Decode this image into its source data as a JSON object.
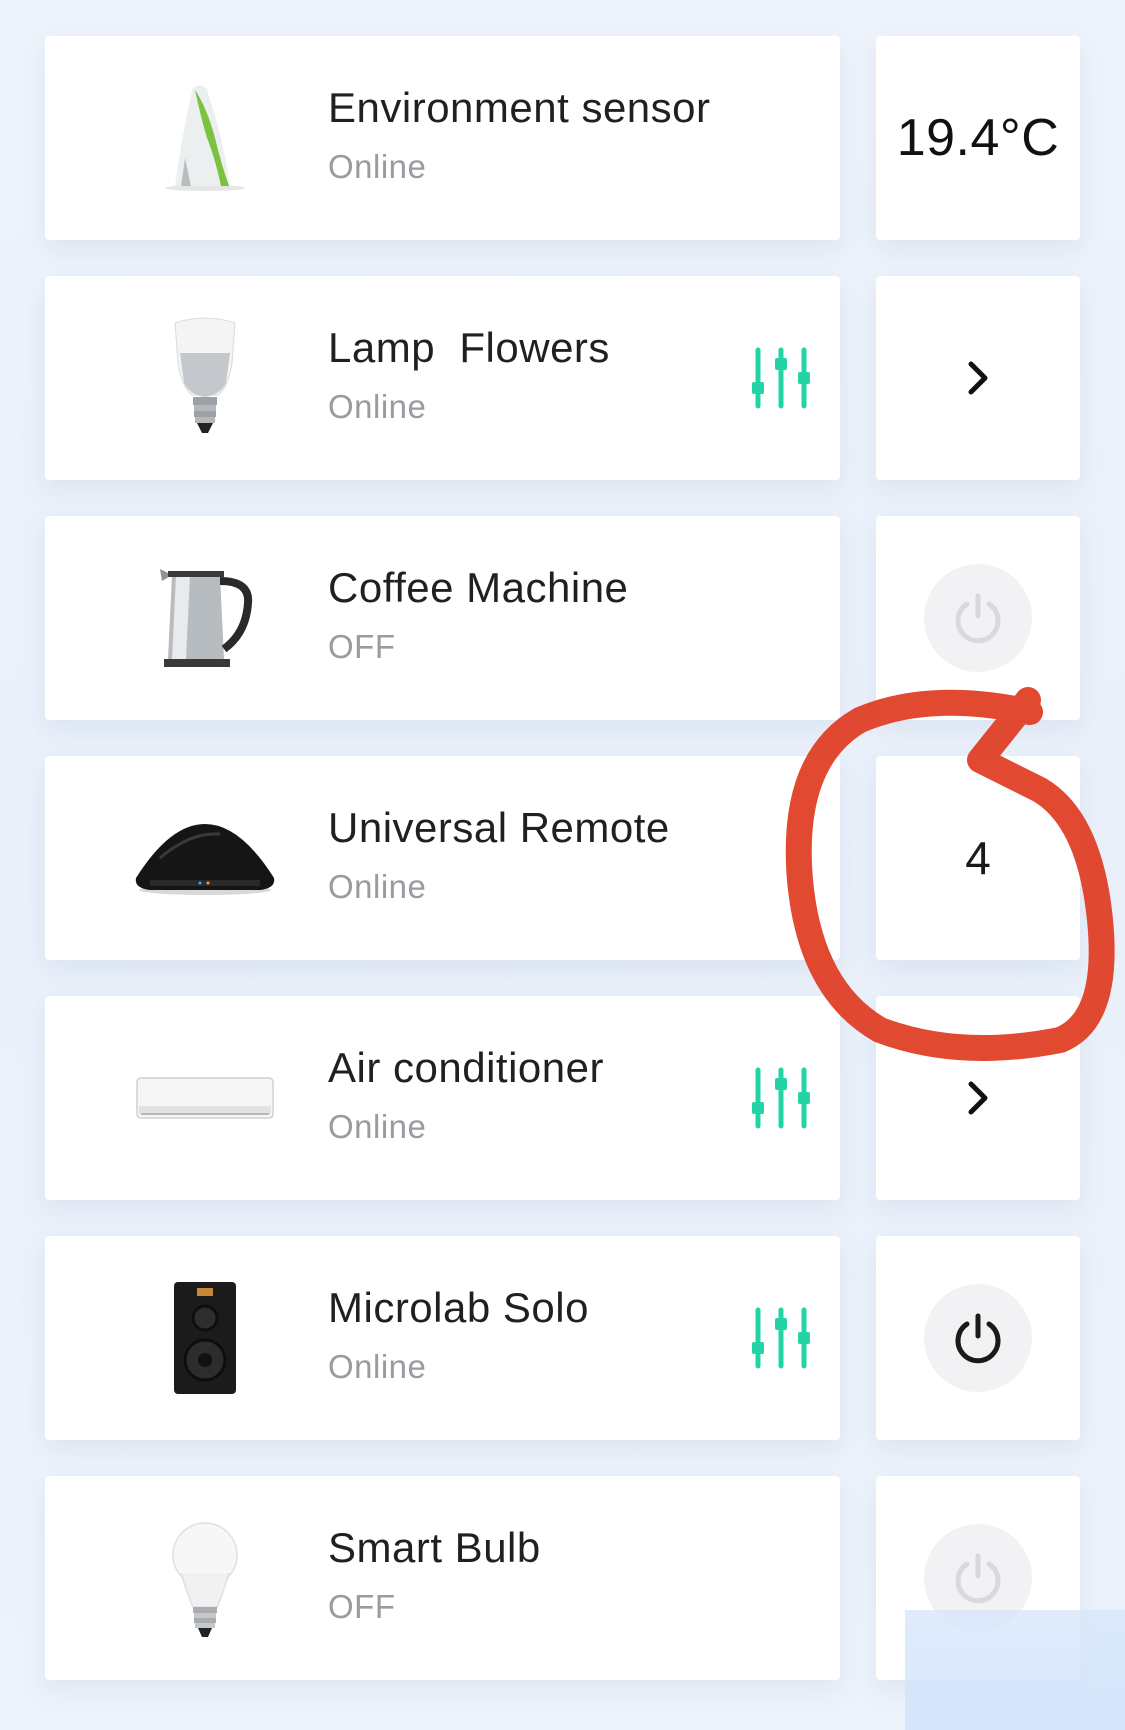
{
  "colors": {
    "accent": "#22d3a5",
    "text": "#1f1f24",
    "muted": "#9a9aa0",
    "annotation": "#e03a1f",
    "power_off": "#d9d9dc",
    "power_on": "#1a1a1a"
  },
  "devices": [
    {
      "name": "Environment sensor",
      "status": "Online",
      "icon": "environment-sensor-icon",
      "action": {
        "type": "value",
        "text": "19.4°C"
      }
    },
    {
      "name": "Lamp  Flowers",
      "status": "Online",
      "icon": "lamp-bulb-icon",
      "has_controls": true,
      "action": {
        "type": "chevron"
      }
    },
    {
      "name": "Coffee Machine",
      "status": "OFF",
      "icon": "kettle-icon",
      "action": {
        "type": "power",
        "state": "off"
      }
    },
    {
      "name": "Universal Remote",
      "status": "Online",
      "icon": "universal-remote-icon",
      "action": {
        "type": "count",
        "text": "4"
      }
    },
    {
      "name": "Air conditioner",
      "status": "Online",
      "icon": "air-conditioner-icon",
      "has_controls": true,
      "action": {
        "type": "chevron"
      }
    },
    {
      "name": "Microlab Solo",
      "status": "Online",
      "icon": "speaker-icon",
      "has_controls": true,
      "action": {
        "type": "power",
        "state": "on"
      }
    },
    {
      "name": "Smart Bulb",
      "status": "OFF",
      "icon": "smart-bulb-icon",
      "action": {
        "type": "power",
        "state": "off"
      }
    }
  ]
}
